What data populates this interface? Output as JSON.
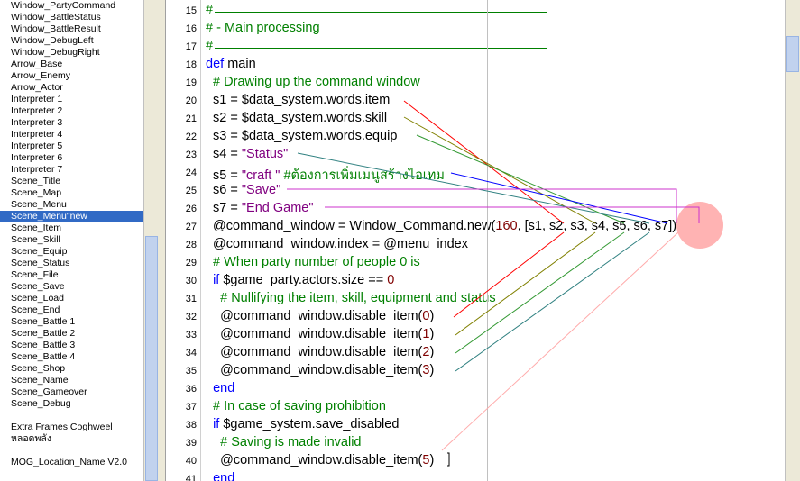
{
  "script_list": {
    "items": [
      {
        "label": "Window_PartyCommand"
      },
      {
        "label": "Window_BattleStatus"
      },
      {
        "label": "Window_BattleResult"
      },
      {
        "label": "Window_DebugLeft"
      },
      {
        "label": "Window_DebugRight"
      },
      {
        "label": "Arrow_Base"
      },
      {
        "label": "Arrow_Enemy"
      },
      {
        "label": "Arrow_Actor"
      },
      {
        "label": "Interpreter 1"
      },
      {
        "label": "Interpreter 2"
      },
      {
        "label": "Interpreter 3"
      },
      {
        "label": "Interpreter 4"
      },
      {
        "label": "Interpreter 5"
      },
      {
        "label": "Interpreter 6"
      },
      {
        "label": "Interpreter 7"
      },
      {
        "label": "Scene_Title"
      },
      {
        "label": "Scene_Map"
      },
      {
        "label": "Scene_Menu"
      },
      {
        "label": "Scene_Menu\"new",
        "selected": true
      },
      {
        "label": "Scene_Item"
      },
      {
        "label": "Scene_Skill"
      },
      {
        "label": "Scene_Equip"
      },
      {
        "label": "Scene_Status"
      },
      {
        "label": "Scene_File"
      },
      {
        "label": "Scene_Save"
      },
      {
        "label": "Scene_Load"
      },
      {
        "label": "Scene_End"
      },
      {
        "label": "Scene_Battle 1"
      },
      {
        "label": "Scene_Battle 2"
      },
      {
        "label": "Scene_Battle 3"
      },
      {
        "label": "Scene_Battle 4"
      },
      {
        "label": "Scene_Shop"
      },
      {
        "label": "Scene_Name"
      },
      {
        "label": "Scene_Gameover"
      },
      {
        "label": "Scene_Debug"
      },
      {
        "label": "",
        "gap": true
      },
      {
        "label": "Extra Frames Coghweel"
      },
      {
        "label": "หลอดพลัง"
      },
      {
        "label": "",
        "gap": true
      },
      {
        "label": "MOG_Location_Name V2.0"
      }
    ]
  },
  "code": {
    "lines": [
      {
        "num": "15",
        "tokens": [
          {
            "t": "#",
            "c": "comment"
          }
        ],
        "rule": true
      },
      {
        "num": "16",
        "tokens": [
          {
            "t": "# - Main processing",
            "c": "comment"
          }
        ]
      },
      {
        "num": "17",
        "tokens": [
          {
            "t": "#",
            "c": "comment"
          }
        ],
        "rule": true
      },
      {
        "num": "18",
        "tokens": [
          {
            "t": "def",
            "c": "keyword"
          },
          {
            "t": " main",
            "c": "plain"
          }
        ]
      },
      {
        "num": "19",
        "tokens": [
          {
            "t": "  # Drawing up the command window",
            "c": "comment"
          }
        ]
      },
      {
        "num": "20",
        "tokens": [
          {
            "t": "  s1 = $data_system.words.item",
            "c": "plain"
          }
        ]
      },
      {
        "num": "21",
        "tokens": [
          {
            "t": "  s2 = $data_system.words.skill",
            "c": "plain"
          }
        ]
      },
      {
        "num": "22",
        "tokens": [
          {
            "t": "  s3 = $data_system.words.equip",
            "c": "plain"
          }
        ]
      },
      {
        "num": "23",
        "tokens": [
          {
            "t": "  s4 = ",
            "c": "plain"
          },
          {
            "t": "\"Status\"",
            "c": "string"
          }
        ]
      },
      {
        "num": "24",
        "tokens": [
          {
            "t": "  s5 = ",
            "c": "plain"
          },
          {
            "t": "\"craft \"",
            "c": "string"
          },
          {
            "t": " #ต้องการเพิ่มเมนูสร้างไอเทม",
            "c": "comment"
          }
        ]
      },
      {
        "num": "25",
        "tokens": [
          {
            "t": "  s6 = ",
            "c": "plain"
          },
          {
            "t": "\"Save\"",
            "c": "string"
          }
        ]
      },
      {
        "num": "26",
        "tokens": [
          {
            "t": "  s7 = ",
            "c": "plain"
          },
          {
            "t": "\"End Game\"",
            "c": "string"
          }
        ]
      },
      {
        "num": "27",
        "tokens": [
          {
            "t": "  @command_window = Window_Command.new(",
            "c": "plain"
          },
          {
            "t": "160",
            "c": "number"
          },
          {
            "t": ", [s1, s2, s3, s4, s5, s6, s7])",
            "c": "plain"
          }
        ]
      },
      {
        "num": "28",
        "tokens": [
          {
            "t": "  @command_window.index = @menu_index",
            "c": "plain"
          }
        ]
      },
      {
        "num": "29",
        "tokens": [
          {
            "t": "  # When party number of people 0 is",
            "c": "comment"
          }
        ]
      },
      {
        "num": "30",
        "tokens": [
          {
            "t": "  ",
            "c": "plain"
          },
          {
            "t": "if",
            "c": "keyword"
          },
          {
            "t": " $game_party.actors.size == ",
            "c": "plain"
          },
          {
            "t": "0",
            "c": "number"
          }
        ]
      },
      {
        "num": "31",
        "tokens": [
          {
            "t": "    # Nullifying the item, skill, equipment and status",
            "c": "comment"
          }
        ]
      },
      {
        "num": "32",
        "tokens": [
          {
            "t": "    @command_window.disable_item(",
            "c": "plain"
          },
          {
            "t": "0",
            "c": "number"
          },
          {
            "t": ")",
            "c": "plain"
          }
        ]
      },
      {
        "num": "33",
        "tokens": [
          {
            "t": "    @command_window.disable_item(",
            "c": "plain"
          },
          {
            "t": "1",
            "c": "number"
          },
          {
            "t": ")",
            "c": "plain"
          }
        ]
      },
      {
        "num": "34",
        "tokens": [
          {
            "t": "    @command_window.disable_item(",
            "c": "plain"
          },
          {
            "t": "2",
            "c": "number"
          },
          {
            "t": ")",
            "c": "plain"
          }
        ]
      },
      {
        "num": "35",
        "tokens": [
          {
            "t": "    @command_window.disable_item(",
            "c": "plain"
          },
          {
            "t": "3",
            "c": "number"
          },
          {
            "t": ")",
            "c": "plain"
          }
        ]
      },
      {
        "num": "36",
        "tokens": [
          {
            "t": "  ",
            "c": "plain"
          },
          {
            "t": "end",
            "c": "keyword"
          }
        ]
      },
      {
        "num": "37",
        "tokens": [
          {
            "t": "  # In case of saving prohibition",
            "c": "comment"
          }
        ]
      },
      {
        "num": "38",
        "tokens": [
          {
            "t": "  ",
            "c": "plain"
          },
          {
            "t": "if",
            "c": "keyword"
          },
          {
            "t": " $game_system.save_disabled",
            "c": "plain"
          }
        ]
      },
      {
        "num": "39",
        "tokens": [
          {
            "t": "    # Saving is made invalid",
            "c": "comment"
          }
        ]
      },
      {
        "num": "40",
        "tokens": [
          {
            "t": "    @command_window.disable_item(",
            "c": "plain"
          },
          {
            "t": "5",
            "c": "number"
          },
          {
            "t": ")",
            "c": "plain"
          }
        ]
      },
      {
        "num": "41",
        "tokens": [
          {
            "t": "  ",
            "c": "plain"
          },
          {
            "t": "end",
            "c": "keyword"
          }
        ]
      }
    ]
  },
  "colors": {
    "comment": "#008000",
    "keyword": "#0000ff",
    "string": "#800080",
    "number": "#800000",
    "selection": "#316ac5",
    "arrow_red": "#ff0000",
    "arrow_olive": "#808000",
    "arrow_green": "#339933",
    "arrow_teal": "#2f8080",
    "arrow_blue": "#0000ff",
    "arrow_magenta": "#cc33cc",
    "arrow_pink": "#ffaaaa",
    "highlight_circle": "#ff9999"
  }
}
